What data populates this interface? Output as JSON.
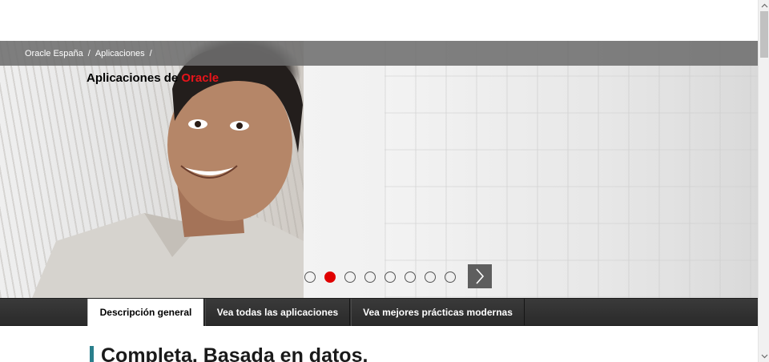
{
  "breadcrumb": {
    "items": [
      "Oracle España",
      "Aplicaciones"
    ],
    "separator": "/"
  },
  "hero": {
    "title_main": "Aplicaciones de ",
    "title_accent": "Oracle",
    "accent_color": "#e8141a"
  },
  "carousel": {
    "slide_count": 8,
    "active_index": 1,
    "active_color": "#e00000",
    "next_icon": "chevron-right-icon"
  },
  "tabs": [
    {
      "label": "Descripción general",
      "active": true
    },
    {
      "label": "Vea todas las aplicaciones",
      "active": false
    },
    {
      "label": "Vea mejores prácticas modernas",
      "active": false
    }
  ],
  "content": {
    "heading": "Completa. Basada en datos.",
    "marker_color": "#2a7f8c"
  },
  "scrollbar": {
    "up_icon": "scroll-up-icon",
    "down_icon": "scroll-down-icon"
  }
}
